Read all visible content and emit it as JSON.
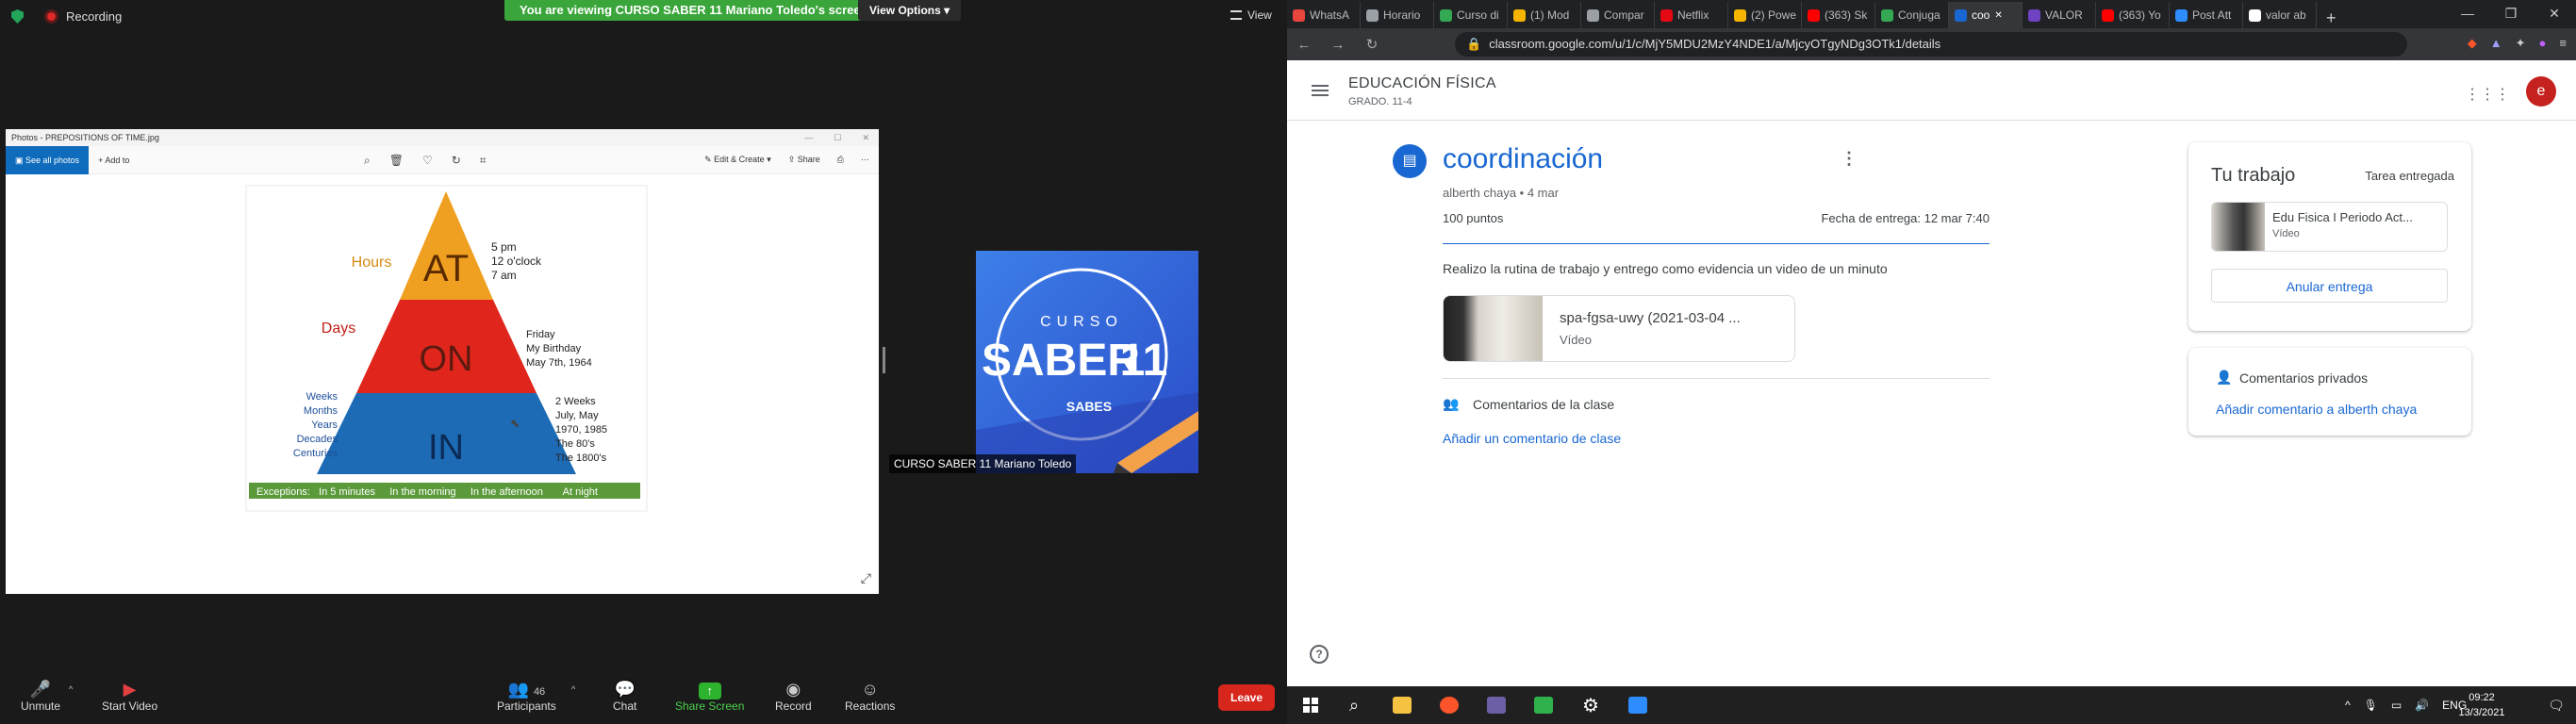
{
  "zoom": {
    "recording_label": "Recording",
    "banner_text": "You are viewing CURSO SABER 11 Mariano Toledo's screen",
    "view_options": "View Options",
    "view_label": "View",
    "name_tag": "CURSO SABER 11 Mariano Toledo",
    "bottom": {
      "unmute": "Unmute",
      "start_video": "Start Video",
      "participants": "Participants",
      "participants_count": "46",
      "chat": "Chat",
      "share_screen": "Share Screen",
      "record": "Record",
      "reactions": "Reactions",
      "leave": "Leave"
    }
  },
  "photos": {
    "title": "Photos - PREPOSITIONS OF TIME.jpg",
    "see_all": "See all photos",
    "add_to": "Add to",
    "edit_create": "Edit & Create",
    "share": "Share",
    "diagram": {
      "at": "AT",
      "on": "ON",
      "in": "IN",
      "hours": "Hours",
      "days": "Days",
      "left_in": [
        "Weeks",
        "Months",
        "Years",
        "Decades",
        "Centuries"
      ],
      "at_items": [
        "5 pm",
        "12 o'clock",
        "7 am"
      ],
      "on_items": [
        "Friday",
        "My Birthday",
        "May 7th, 1964"
      ],
      "in_items": [
        "2 Weeks",
        "July, May",
        "1970, 1985",
        "The 80's",
        "The 1800's"
      ],
      "exceptions": "Exceptions:   In 5 minutes     In the morning     In the afternoon       At night"
    }
  },
  "saber": {
    "curso": "CURSO",
    "saber": "SABER",
    "num": "11",
    "brand": "SABES"
  },
  "browser": {
    "tabs": [
      {
        "label": "WhatsA",
        "color": "#e8453c"
      },
      {
        "label": "Horario",
        "color": "#9aa0a6"
      },
      {
        "label": "Curso di",
        "color": "#34a853"
      },
      {
        "label": "(1) Mod",
        "color": "#f4b400"
      },
      {
        "label": "Compar",
        "color": "#9aa0a6"
      },
      {
        "label": "Netflix",
        "color": "#e50914"
      },
      {
        "label": "(2) Powe",
        "color": "#f4b400"
      },
      {
        "label": "(363) Sk",
        "color": "#ff0000"
      },
      {
        "label": "Conjuga",
        "color": "#34a853"
      },
      {
        "label": "coo",
        "color": "#1967d2"
      },
      {
        "label": "VALOR",
        "color": "#6f42c1"
      },
      {
        "label": "(363) Yo",
        "color": "#ff0000"
      },
      {
        "label": "Post Att",
        "color": "#2d8cff"
      },
      {
        "label": "valor ab",
        "color": "#ffffff"
      }
    ],
    "url": "classroom.google.com/u/1/c/MjY5MDU2MzY4NDE1/a/MjcyOTgyNDg3OTk1/details"
  },
  "classroom": {
    "course": "EDUCACIÓN FÍSICA",
    "section": "GRADO. 11-4",
    "avatar": "e",
    "title": "coordinación",
    "meta": "alberth chaya • 4 mar",
    "points": "100 puntos",
    "due": "Fecha de entrega: 12 mar 7:40",
    "instructions": "Realizo la rutina de trabajo y entrego como evidencia un video de un minuto",
    "attachment_title": "spa-fgsa-uwy (2021-03-04 ...",
    "attachment_type": "Vídeo",
    "comments_title": "Comentarios de la clase",
    "add_comment": "Añadir un comentario de clase",
    "your_work": "Tu trabajo",
    "status": "Tarea entregada",
    "work_title": "Edu Fisica I Periodo Act...",
    "work_type": "Vídeo",
    "undo": "Anular entrega",
    "private_title": "Comentarios privados",
    "private_add": "Añadir comentario a alberth chaya"
  },
  "taskbar": {
    "lang": "ENG",
    "time": "09:22",
    "date": "13/3/2021"
  }
}
